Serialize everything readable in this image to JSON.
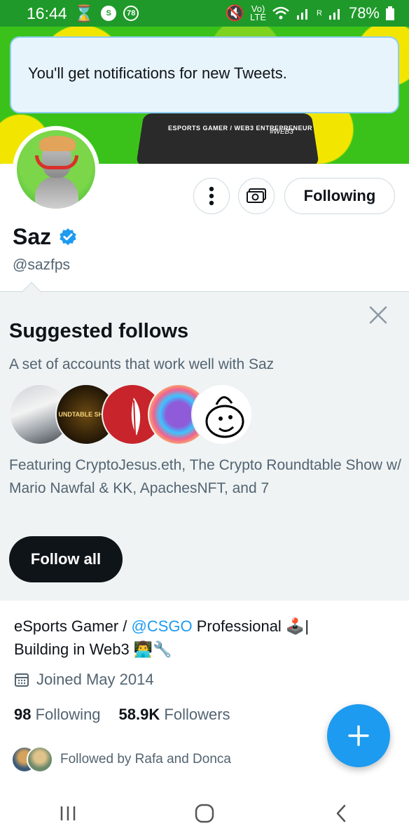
{
  "status_bar": {
    "time": "16:44",
    "notif_badge": "78",
    "network_top": "Vo)",
    "network_bottom": "LTE",
    "signal_label": "R",
    "battery": "78%"
  },
  "banner": {
    "plate_text": "ESPORTS GAMER / WEB3 ENTREPRENEUR",
    "plate_sig": "#WEB3"
  },
  "toast": {
    "message": "You'll get notifications for new Tweets."
  },
  "profile": {
    "name": "Saz",
    "handle": "@sazfps",
    "following_button": "Following",
    "more_icon": "more-vertical-icon",
    "tip_icon": "money-icon",
    "verified_color": "#1d9bf0"
  },
  "suggested": {
    "title": "Suggested follows",
    "subtitle": "A set of accounts that work well with Saz",
    "featuring": "Featuring CryptoJesus.eth, The Crypto Roundtable Show w/ Mario Nawfal & KK, ApachesNFT, and 7",
    "follow_all": "Follow all",
    "avatar2_text": "UNDTABLE SHOW"
  },
  "bio": {
    "line1_prefix": "eSports Gamer / ",
    "mention": "@CSGO",
    "line1_suffix": " Professional 🕹️|",
    "line2": "Building in Web3 👨‍💻🔧"
  },
  "joined": "Joined May 2014",
  "stats": {
    "following_count": "98",
    "following_label": "Following",
    "followers_count": "58.9K",
    "followers_label": "Followers"
  },
  "followed_by": "Followed by Rafa and Donca",
  "colors": {
    "accent": "#1d9bf0",
    "status_bar": "#1f9a2a",
    "panel_bg": "#eff3f4"
  }
}
